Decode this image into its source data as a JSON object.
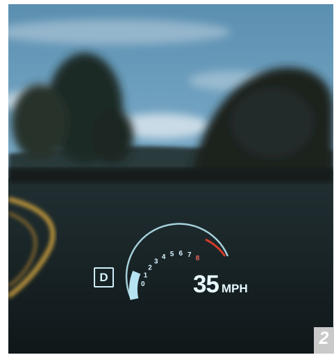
{
  "hud": {
    "gear": "D",
    "speed": "35",
    "unit": "MPH",
    "tach_ticks": [
      "0",
      "1",
      "2",
      "3",
      "4",
      "5",
      "6",
      "7",
      "8"
    ],
    "tach_level_fraction": 0.2
  },
  "badge": {
    "label": "2"
  },
  "colors": {
    "hud_cyan": "#bfeefc",
    "redline": "#d23a2a",
    "sky": "#6f9ebb",
    "road": "#1e2a2c"
  }
}
